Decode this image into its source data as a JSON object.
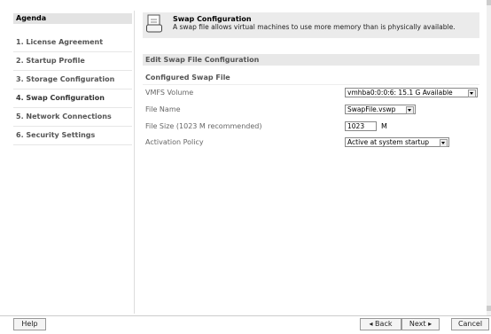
{
  "agenda": {
    "title": "Agenda",
    "items": [
      {
        "label": "1. License Agreement"
      },
      {
        "label": "2. Startup Profile"
      },
      {
        "label": "3. Storage Configuration"
      },
      {
        "label": "4. Swap Configuration"
      },
      {
        "label": "5. Network Connections"
      },
      {
        "label": "6. Security Settings"
      }
    ]
  },
  "banner": {
    "title": "Swap Configuration",
    "description": "A swap file allows virtual machines to use more memory than is physically available."
  },
  "section": {
    "title": "Edit Swap File Configuration",
    "subtitle": "Configured Swap File"
  },
  "fields": {
    "vmfs": {
      "label": "VMFS Volume",
      "value": "vmhba0:0:0:6: 15.1 G Available"
    },
    "filename": {
      "label": "File Name",
      "value": "SwapFile.vswp"
    },
    "filesize": {
      "label": "File Size (1023 M recommended)",
      "value": "1023",
      "unit": "M"
    },
    "activation": {
      "label": "Activation Policy",
      "value": "Active at system startup"
    }
  },
  "footer": {
    "help": "Help",
    "back": "◂ Back",
    "next": "Next ▸",
    "cancel": "Cancel"
  }
}
